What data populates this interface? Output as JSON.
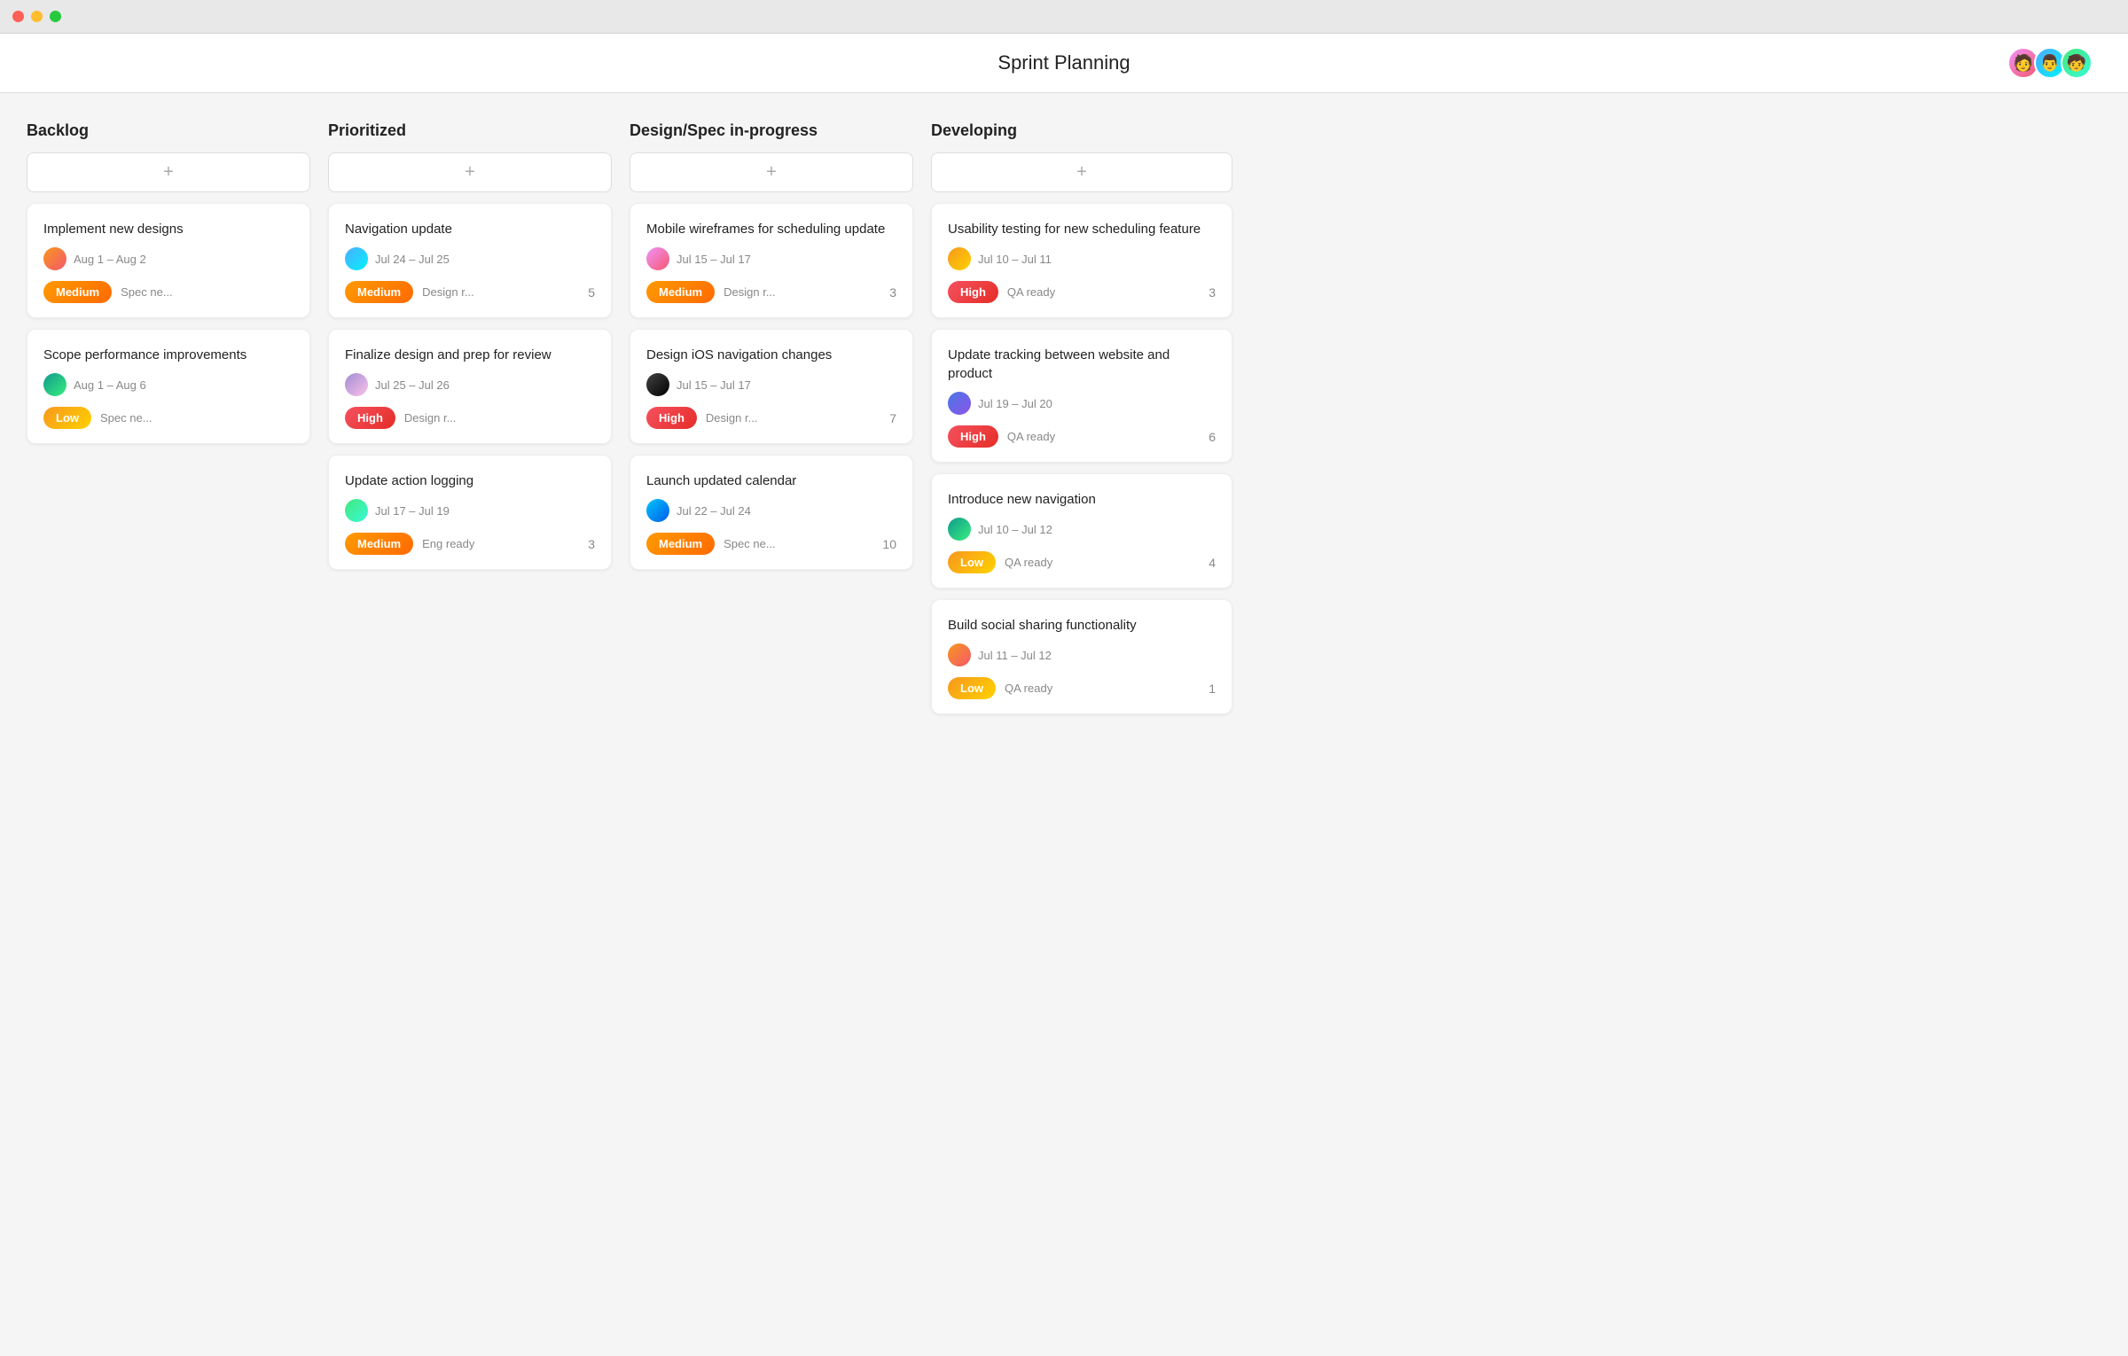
{
  "titlebar": {
    "dots": [
      "red",
      "yellow",
      "green"
    ]
  },
  "header": {
    "title": "Sprint Planning",
    "avatars": [
      {
        "id": "avatar-1",
        "color": "av-purple",
        "emoji": "👩"
      },
      {
        "id": "avatar-2",
        "color": "av-teal",
        "emoji": "👨"
      },
      {
        "id": "avatar-3",
        "color": "av-orange",
        "emoji": "👦"
      }
    ]
  },
  "columns": [
    {
      "id": "backlog",
      "title": "Backlog",
      "add_label": "+",
      "cards": [
        {
          "title": "Implement new designs",
          "avatar_color": "av-orange",
          "date": "Aug 1 – Aug 2",
          "badge": "Medium",
          "badge_class": "badge-medium",
          "status": "Spec ne...",
          "count": null
        },
        {
          "title": "Scope performance improvements",
          "avatar_color": "av-teal",
          "date": "Aug 1 – Aug 6",
          "badge": "Low",
          "badge_class": "badge-low",
          "status": "Spec ne...",
          "count": null
        }
      ]
    },
    {
      "id": "prioritized",
      "title": "Prioritized",
      "add_label": "+",
      "cards": [
        {
          "title": "Navigation update",
          "avatar_color": "av-blue",
          "date": "Jul 24 – Jul 25",
          "badge": "Medium",
          "badge_class": "badge-medium",
          "status": "Design r...",
          "count": "5"
        },
        {
          "title": "Finalize design and prep for review",
          "avatar_color": "av-purple",
          "date": "Jul 25 – Jul 26",
          "badge": "High",
          "badge_class": "badge-high",
          "status": "Design r...",
          "count": null
        },
        {
          "title": "Update action logging",
          "avatar_color": "av-green",
          "date": "Jul 17 – Jul 19",
          "badge": "Medium",
          "badge_class": "badge-medium",
          "status": "Eng ready",
          "count": "3"
        }
      ]
    },
    {
      "id": "design-spec",
      "title": "Design/Spec in-progress",
      "add_label": "+",
      "cards": [
        {
          "title": "Mobile wireframes for scheduling update",
          "avatar_color": "av-pink",
          "date": "Jul 15 – Jul 17",
          "badge": "Medium",
          "badge_class": "badge-medium",
          "status": "Design r...",
          "count": "3"
        },
        {
          "title": "Design iOS navigation changes",
          "avatar_color": "av-dark",
          "date": "Jul 15 – Jul 17",
          "badge": "High",
          "badge_class": "badge-high",
          "status": "Design r...",
          "count": "7"
        },
        {
          "title": "Launch updated calendar",
          "avatar_color": "av-cyan",
          "date": "Jul 22 – Jul 24",
          "badge": "Medium",
          "badge_class": "badge-medium",
          "status": "Spec ne...",
          "count": "10"
        }
      ]
    },
    {
      "id": "developing",
      "title": "Developing",
      "add_label": "+",
      "cards": [
        {
          "title": "Usability testing for new scheduling feature",
          "avatar_color": "av-yellow",
          "date": "Jul 10 – Jul 11",
          "badge": "High",
          "badge_class": "badge-high",
          "status": "QA ready",
          "count": "3"
        },
        {
          "title": "Update tracking between website and product",
          "avatar_color": "av-indigo",
          "date": "Jul 19 – Jul 20",
          "badge": "High",
          "badge_class": "badge-high",
          "status": "QA ready",
          "count": "6"
        },
        {
          "title": "Introduce new navigation",
          "avatar_color": "av-teal",
          "date": "Jul 10 – Jul 12",
          "badge": "Low",
          "badge_class": "badge-low",
          "status": "QA ready",
          "count": "4"
        },
        {
          "title": "Build social sharing functionality",
          "avatar_color": "av-orange",
          "date": "Jul 11 – Jul 12",
          "badge": "Low",
          "badge_class": "badge-low",
          "status": "QA ready",
          "count": "1"
        }
      ]
    }
  ]
}
